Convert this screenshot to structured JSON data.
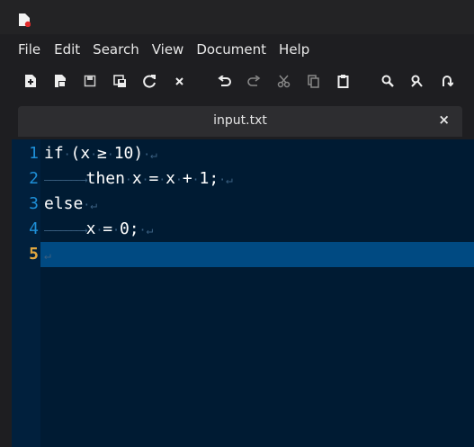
{
  "menubar": {
    "items": [
      "File",
      "Edit",
      "Search",
      "View",
      "Document",
      "Help"
    ]
  },
  "toolbar": {
    "buttons": [
      {
        "name": "new-file",
        "icon": "new-file-icon"
      },
      {
        "name": "open-file",
        "icon": "open-file-icon"
      },
      {
        "name": "save",
        "icon": "save-icon"
      },
      {
        "name": "save-all",
        "icon": "save-all-icon"
      },
      {
        "name": "reload",
        "icon": "reload-icon"
      },
      {
        "name": "close",
        "icon": "close-icon"
      },
      {
        "name": "undo",
        "icon": "undo-icon"
      },
      {
        "name": "redo",
        "icon": "redo-icon"
      },
      {
        "name": "cut",
        "icon": "cut-icon"
      },
      {
        "name": "copy",
        "icon": "copy-icon"
      },
      {
        "name": "paste",
        "icon": "paste-icon"
      },
      {
        "name": "find",
        "icon": "search-icon"
      },
      {
        "name": "find-replace",
        "icon": "find-replace-icon"
      },
      {
        "name": "goto",
        "icon": "goto-icon"
      }
    ]
  },
  "tab": {
    "title": "input.txt",
    "close": "×"
  },
  "editor": {
    "lines": [
      {
        "number": "1",
        "tokens": [
          "if",
          "·",
          "(x",
          "·",
          "≥",
          "·",
          "10)",
          "·",
          "↵"
        ]
      },
      {
        "number": "2",
        "tokens": [
          "→",
          "then",
          "·",
          "x",
          "·",
          "=",
          "·",
          "x",
          "·",
          "+",
          "·",
          "1;",
          "·",
          "↵"
        ]
      },
      {
        "number": "3",
        "tokens": [
          "else",
          "·",
          "↵"
        ]
      },
      {
        "number": "4",
        "tokens": [
          "→",
          "x",
          "·",
          "=",
          "·",
          "0;",
          "·",
          "↵"
        ]
      },
      {
        "number": "5",
        "tokens": [
          "↵"
        ]
      }
    ],
    "current_line": "5",
    "colors": {
      "background": "#001b33",
      "current_line": "#004a82",
      "line_number": "#1e8fd8",
      "current_line_number": "#e2a73f",
      "whitespace": "#3a5f80"
    }
  }
}
